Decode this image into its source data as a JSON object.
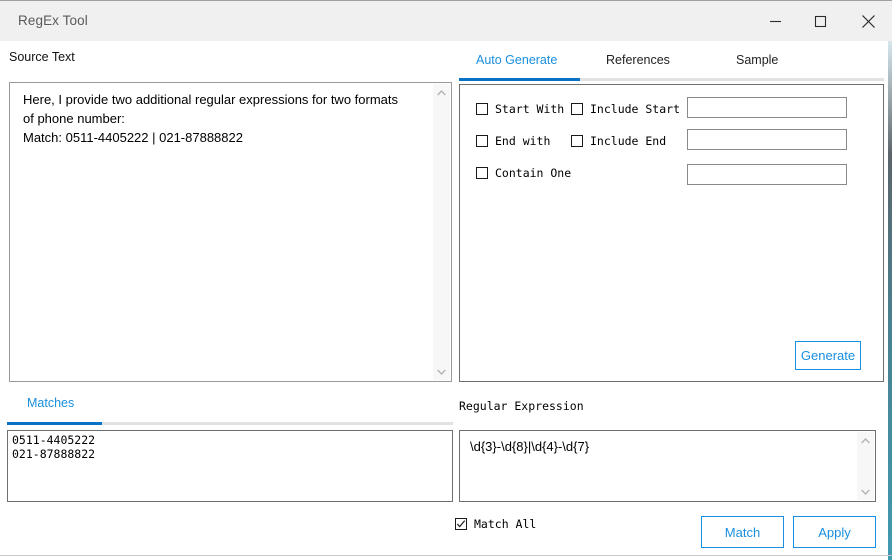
{
  "window": {
    "title": "RegEx Tool",
    "controls": {
      "minimize": "minimize-icon",
      "maximize": "maximize-icon",
      "close": "close-icon"
    }
  },
  "source": {
    "label": "Source Text",
    "text": "Here, I provide two additional regular expressions for two formats of phone number:\nMatch: 0511-4405222 | 021-87888822"
  },
  "right_tabs": {
    "items": [
      {
        "label": "Auto Generate",
        "active": true
      },
      {
        "label": "References",
        "active": false
      },
      {
        "label": "Sample",
        "active": false
      }
    ]
  },
  "auto_generate": {
    "checkboxes": [
      {
        "name": "start-with",
        "label": "Start With",
        "checked": false
      },
      {
        "name": "include-start",
        "label": "Include Start",
        "checked": false
      },
      {
        "name": "end-with",
        "label": "End with",
        "checked": false
      },
      {
        "name": "include-end",
        "label": "Include End",
        "checked": false
      },
      {
        "name": "contain-one",
        "label": "Contain One",
        "checked": false
      }
    ],
    "inputs": [
      {
        "name": "start-value",
        "value": "",
        "placeholder": ""
      },
      {
        "name": "end-value",
        "value": "",
        "placeholder": ""
      },
      {
        "name": "contain-value",
        "value": "",
        "placeholder": ""
      }
    ],
    "generate_label": "Generate"
  },
  "matches": {
    "tab_label": "Matches",
    "items": "0511-4405222\n021-87888822"
  },
  "regular_expression": {
    "label": "Regular Expression",
    "value": "\\d{3}-\\d{8}|\\d{4}-\\d{7}"
  },
  "footer": {
    "match_all": {
      "label": "Match All",
      "checked": true
    },
    "match_label": "Match",
    "apply_label": "Apply"
  },
  "colors": {
    "accent": "#1a8fe0",
    "accent_underline": "#0a72c4",
    "titlebar_bg": "#f0f0f0",
    "border": "#6f6f6f"
  }
}
